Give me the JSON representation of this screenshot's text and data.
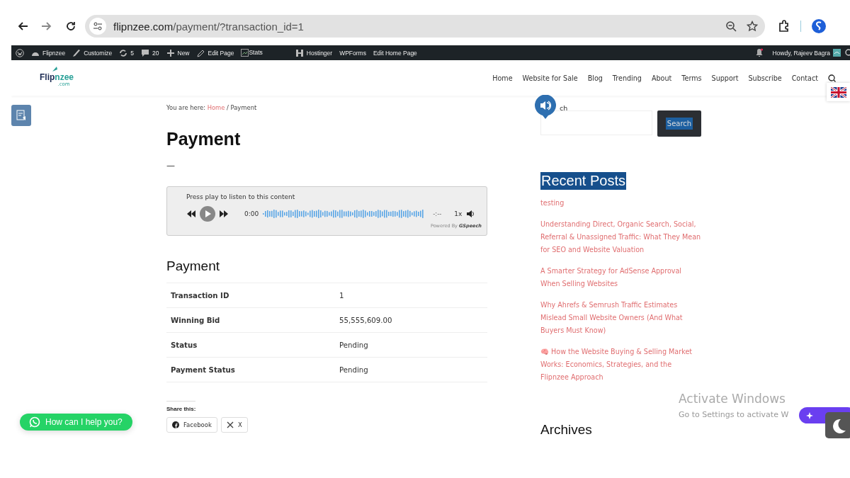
{
  "browser": {
    "url_host": "flipnzee.com",
    "url_path": "/payment/?transaction_id=1"
  },
  "admin_bar": {
    "items": [
      {
        "kind": "wp"
      },
      {
        "kind": "site",
        "label": "Flipnzee"
      },
      {
        "kind": "customize",
        "label": "Customize"
      },
      {
        "kind": "updates",
        "label": "5"
      },
      {
        "kind": "comments",
        "label": "20"
      },
      {
        "kind": "new",
        "label": "New"
      },
      {
        "kind": "edit",
        "label": "Edit Page"
      },
      {
        "kind": "stats",
        "label": "Stats"
      },
      {
        "kind": "hostinger",
        "label": "Hostinger"
      },
      {
        "kind": "text",
        "label": "WPForms"
      },
      {
        "kind": "text",
        "label": "Edit Home Page"
      }
    ],
    "greeting": "Howdy, Rajeev Bagra"
  },
  "header": {
    "logo": "Flipnzee",
    "logo_sub": ".com",
    "nav": [
      "Home",
      "Website for Sale",
      "Blog",
      "Trending",
      "About",
      "Terms",
      "Support",
      "Subscribe",
      "Contact"
    ]
  },
  "breadcrumb": {
    "prefix": "You are here:",
    "link": "Home",
    "rest": "/ Payment"
  },
  "title": "Payment",
  "dash": "—",
  "audio": {
    "prompt": "Press play to listen to this content",
    "time": "0:00",
    "remaining": "-:--",
    "speed": "1x",
    "powered": "Powered By",
    "brand": "GSpeech"
  },
  "section_heading": "Payment",
  "details": [
    {
      "label": "Transaction ID",
      "value": "1"
    },
    {
      "label": "Winning Bid",
      "value": "55,555,609.00"
    },
    {
      "label": "Status",
      "value": "Pending"
    },
    {
      "label": "Payment Status",
      "value": "Pending"
    }
  ],
  "share": {
    "label": "Share this:",
    "buttons": [
      {
        "kind": "facebook",
        "label": "Facebook"
      },
      {
        "kind": "x",
        "label": "X"
      }
    ]
  },
  "sidebar": {
    "search_label": "ch",
    "search_button": "Search",
    "recent_heading": "Recent Posts",
    "posts": [
      "testing",
      "Understanding Direct, Organic Search, Social, Referral & Unassigned Traffic: What They Mean for SEO and Website Valuation",
      "A Smarter Strategy for AdSense Approval When Selling Websites",
      "Why Ahrefs & Semrush Traffic Estimates Mislead Small Website Owners (And What Buyers Must Know)",
      "🧠 How the Website Buying & Selling Market Works: Economics, Strategies, and the Flipnzee Approach"
    ],
    "archives_heading": "Archives"
  },
  "chat_button": "How can I help you?",
  "activation": {
    "title": "Activate Windows",
    "text": "Go to Settings to activate W"
  }
}
